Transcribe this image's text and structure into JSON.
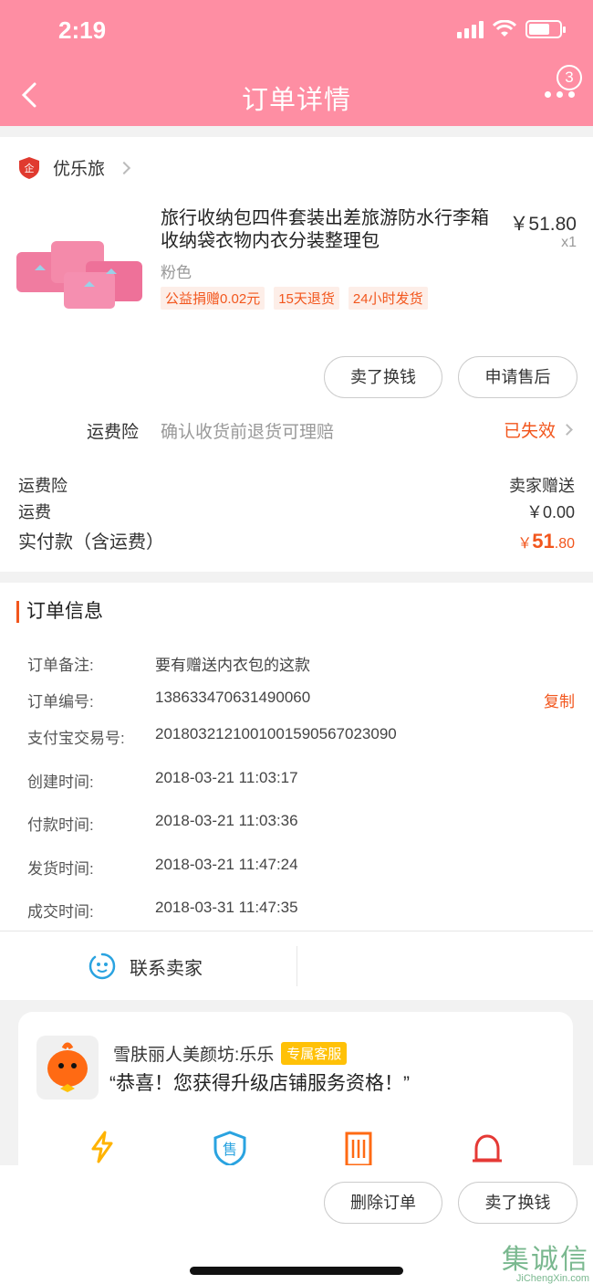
{
  "status_bar": {
    "time": "2:19"
  },
  "header": {
    "title": "订单详情",
    "badge_count": "3"
  },
  "shop": {
    "name": "优乐旅"
  },
  "product": {
    "title": "旅行收纳包四件套装出差旅游防水行李箱收纳袋衣物内衣分装整理包",
    "price": "￥51.80",
    "quantity": "x1",
    "spec": "粉色",
    "tags": [
      "公益捐赠0.02元",
      "15天退货",
      "24小时发货"
    ]
  },
  "actions": {
    "sell_label": "卖了换钱",
    "after_sale_label": "申请售后"
  },
  "insurance": {
    "label": "运费险",
    "desc": "确认收货前退货可理赔",
    "status": "已失效"
  },
  "fees": {
    "insurance_label": "运费险",
    "insurance_value": "卖家赠送",
    "shipping_label": "运费",
    "shipping_value": "￥0.00",
    "total_label": "实付款（含运费）",
    "total_currency": "￥",
    "total_int": "51",
    "total_dec": ".80"
  },
  "order_info": {
    "title": "订单信息",
    "copy_label": "复制",
    "rows": [
      {
        "k": "订单备注:",
        "v": "要有赠送内衣包的这款"
      },
      {
        "k": "订单编号:",
        "v": "138633470631490060"
      },
      {
        "k": "支付宝交易号:",
        "v": "2018032121001001590567023090"
      },
      {
        "k": "创建时间:",
        "v": "2018-03-21 11:03:17"
      },
      {
        "k": "付款时间:",
        "v": "2018-03-21 11:03:36"
      },
      {
        "k": "发货时间:",
        "v": "2018-03-21 11:47:24"
      },
      {
        "k": "成交时间:",
        "v": "2018-03-31 11:47:35"
      }
    ]
  },
  "contact": {
    "label": "联系卖家"
  },
  "service": {
    "name": "雪肤丽人美颜坊:乐乐",
    "badge": "专属客服",
    "message": "“恭喜！您获得升级店铺服务资格！”",
    "icons": [
      "lightning-icon",
      "after-sale-shield-icon",
      "ticket-icon",
      "bell-icon"
    ]
  },
  "bottom_actions": {
    "delete_label": "删除订单",
    "sell_label": "卖了换钱"
  },
  "watermark": {
    "text": "集诚信",
    "url": "JiChengXin.com"
  },
  "colors": {
    "header_bg": "#fe8ea3",
    "accent": "#f2561d"
  }
}
